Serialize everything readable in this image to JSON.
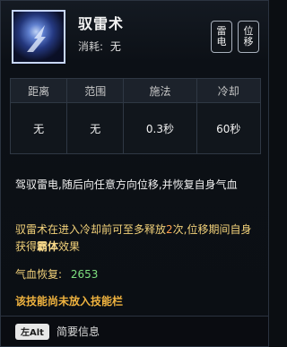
{
  "skill": {
    "name": "驭雷术",
    "cost_label": "消耗:",
    "cost_value": "无",
    "badges": [
      [
        "雷",
        "电"
      ],
      [
        "位",
        "移"
      ]
    ]
  },
  "stats": {
    "headers": [
      "距离",
      "范围",
      "施法",
      "冷却"
    ],
    "values": [
      "无",
      "无",
      "0.3秒",
      "60秒"
    ]
  },
  "description": {
    "line1": "驾驭雷电,随后向任意方向位移,并恢复自身气血",
    "line2_part1": "驭雷术在进入冷却前可至多释放",
    "line2_number": "2",
    "line2_part2": "次,位移期间自身获得",
    "line2_emph": "霸体",
    "line2_part3": "效果",
    "hp_label": "气血恢复:",
    "hp_value": "2653",
    "warning": "该技能尚未放入技能栏"
  },
  "footer": {
    "key": "左Alt",
    "text": "简要信息"
  },
  "icons": {
    "skill": "lightning-figure-icon"
  }
}
